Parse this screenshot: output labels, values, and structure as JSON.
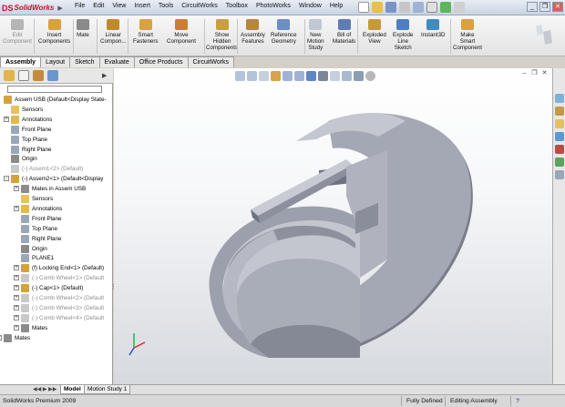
{
  "app": {
    "name": "SolidWorks",
    "logo_mark": "DS"
  },
  "menu": [
    "File",
    "Edit",
    "View",
    "Insert",
    "Tools",
    "CircuitWorks",
    "Toolbox",
    "PhotoWorks",
    "Window",
    "Help"
  ],
  "command_manager": {
    "buttons": [
      {
        "id": "edit-component",
        "lines": [
          "Edit",
          "Component"
        ],
        "icon": "edit-component-icon",
        "color": "#b5b5b5",
        "disabled": true
      },
      {
        "id": "insert-components",
        "lines": [
          "Insert",
          "Components"
        ],
        "icon": "insert-components-icon",
        "color": "#d9a23a",
        "disabled": false
      },
      {
        "id": "mate",
        "lines": [
          "Mate",
          ""
        ],
        "icon": "mate-icon",
        "color": "#8a8a8a",
        "disabled": false
      },
      {
        "id": "linear-component",
        "lines": [
          "Linear",
          "Compon..."
        ],
        "icon": "linear-pattern-icon",
        "color": "#c08a2a",
        "disabled": false
      },
      {
        "id": "smart-fasteners",
        "lines": [
          "Smart",
          "Fasteners"
        ],
        "icon": "smart-fasteners-icon",
        "color": "#d9a23a",
        "disabled": false
      },
      {
        "id": "move-component",
        "lines": [
          "Move",
          "Component"
        ],
        "icon": "move-component-icon",
        "color": "#c97f2f",
        "disabled": false
      },
      {
        "id": "show-hidden",
        "lines": [
          "Show",
          "Hidden",
          "Components"
        ],
        "icon": "show-hidden-icon",
        "color": "#c8a040",
        "disabled": false
      },
      {
        "id": "assembly-features",
        "lines": [
          "Assembly",
          "Features"
        ],
        "icon": "assembly-features-icon",
        "color": "#b6863a",
        "disabled": false
      },
      {
        "id": "reference-geometry",
        "lines": [
          "Reference",
          "Geometry"
        ],
        "icon": "reference-geometry-icon",
        "color": "#6a8fc4",
        "disabled": false
      },
      {
        "id": "new-motion-study",
        "lines": [
          "New",
          "Motion",
          "Study"
        ],
        "icon": "motion-study-icon",
        "color": "#c0c8d4",
        "disabled": false
      },
      {
        "id": "bill-of-materials",
        "lines": [
          "Bill of",
          "Materials"
        ],
        "icon": "bom-icon",
        "color": "#5f7db3",
        "disabled": false
      },
      {
        "id": "exploded-view",
        "lines": [
          "Exploded",
          "View"
        ],
        "icon": "exploded-view-icon",
        "color": "#c59a3c",
        "disabled": false
      },
      {
        "id": "explode-line-sketch",
        "lines": [
          "Explode",
          "Line",
          "Sketch"
        ],
        "icon": "explode-line-sketch-icon",
        "color": "#4e7fbf",
        "disabled": false
      },
      {
        "id": "instant3d",
        "lines": [
          "Instant3D",
          ""
        ],
        "icon": "instant3d-icon",
        "color": "#3f8cc0",
        "disabled": false
      },
      {
        "id": "make-smart-component",
        "lines": [
          "Make",
          "Smart",
          "Component"
        ],
        "icon": "smart-component-icon",
        "color": "#d9a23a",
        "disabled": false
      }
    ]
  },
  "command_tabs": [
    {
      "label": "Assembly",
      "active": true
    },
    {
      "label": "Layout",
      "active": false
    },
    {
      "label": "Sketch",
      "active": false
    },
    {
      "label": "Evaluate",
      "active": false
    },
    {
      "label": "Office Products",
      "active": false
    },
    {
      "label": "CircuitWorks",
      "active": false
    }
  ],
  "feature_tree": {
    "nodes": [
      {
        "label": "Assem USB  (Default<Display State-",
        "level": 0,
        "icon": "assembly-icon",
        "color": "#d4a23a",
        "expander": "",
        "grey": false
      },
      {
        "label": "Sensors",
        "level": 1,
        "icon": "sensors-icon",
        "color": "#e6c35a",
        "expander": "",
        "grey": false
      },
      {
        "label": "Annotations",
        "level": 1,
        "icon": "annotations-icon",
        "color": "#e2b94a",
        "expander": "+",
        "grey": false
      },
      {
        "label": "Front Plane",
        "level": 1,
        "icon": "plane-icon",
        "color": "#9aa7b8",
        "expander": "",
        "grey": false
      },
      {
        "label": "Top Plane",
        "level": 1,
        "icon": "plane-icon",
        "color": "#9aa7b8",
        "expander": "",
        "grey": false
      },
      {
        "label": "Right Plane",
        "level": 1,
        "icon": "plane-icon",
        "color": "#9aa7b8",
        "expander": "",
        "grey": false
      },
      {
        "label": "Origin",
        "level": 1,
        "icon": "origin-icon",
        "color": "#8a8a8a",
        "expander": "",
        "grey": false
      },
      {
        "label": "(-) Assem1<2> (Default)",
        "level": 1,
        "icon": "subassembly-icon",
        "color": "#c9c9c9",
        "expander": "",
        "grey": true
      },
      {
        "label": "(-) Assem2<1> (Default<Display",
        "level": 1,
        "icon": "subassembly-icon",
        "color": "#d4a23a",
        "expander": "-",
        "grey": false
      },
      {
        "label": "Mates in Assem USB",
        "level": 2,
        "icon": "mates-icon",
        "color": "#8c8c8c",
        "expander": "+",
        "grey": false
      },
      {
        "label": "Sensors",
        "level": 2,
        "icon": "sensors-icon",
        "color": "#e6c35a",
        "expander": "",
        "grey": false
      },
      {
        "label": "Annotations",
        "level": 2,
        "icon": "annotations-icon",
        "color": "#e2b94a",
        "expander": "+",
        "grey": false
      },
      {
        "label": "Front Plane",
        "level": 2,
        "icon": "plane-icon",
        "color": "#9aa7b8",
        "expander": "",
        "grey": false
      },
      {
        "label": "Top Plane",
        "level": 2,
        "icon": "plane-icon",
        "color": "#9aa7b8",
        "expander": "",
        "grey": false
      },
      {
        "label": "Right Plane",
        "level": 2,
        "icon": "plane-icon",
        "color": "#9aa7b8",
        "expander": "",
        "grey": false
      },
      {
        "label": "Origin",
        "level": 2,
        "icon": "origin-icon",
        "color": "#8a8a8a",
        "expander": "",
        "grey": false
      },
      {
        "label": "PLANE1",
        "level": 2,
        "icon": "plane-icon",
        "color": "#9aa7b8",
        "expander": "",
        "grey": false
      },
      {
        "label": "(f) Locking End<1> (Default)",
        "level": 2,
        "icon": "part-icon",
        "color": "#d4a23a",
        "expander": "+",
        "grey": false
      },
      {
        "label": "(-) Comb Wheel<1> (Default",
        "level": 2,
        "icon": "part-icon",
        "color": "#c9c9c9",
        "expander": "+",
        "grey": true
      },
      {
        "label": "(-) Cap<1> (Default)",
        "level": 2,
        "icon": "part-icon",
        "color": "#d4a23a",
        "expander": "+",
        "grey": false
      },
      {
        "label": "(-) Comb Wheel<2> (Default",
        "level": 2,
        "icon": "part-icon",
        "color": "#c9c9c9",
        "expander": "+",
        "grey": true
      },
      {
        "label": "(-) Comb Wheel<3> (Default",
        "level": 2,
        "icon": "part-icon",
        "color": "#c9c9c9",
        "expander": "+",
        "grey": true
      },
      {
        "label": "(-) Comb Wheel<4> (Default",
        "level": 2,
        "icon": "part-icon",
        "color": "#c9c9c9",
        "expander": "+",
        "grey": true
      },
      {
        "label": "Mates",
        "level": 2,
        "icon": "mates-icon",
        "color": "#8c8c8c",
        "expander": "+",
        "grey": false
      },
      {
        "label": "Mates",
        "level": 0,
        "icon": "mates-icon",
        "color": "#8c8c8c",
        "expander": "+",
        "grey": false
      }
    ]
  },
  "bottom_tabs": [
    {
      "label": "Model",
      "active": true
    },
    {
      "label": "Motion Study 1",
      "active": false
    }
  ],
  "status": {
    "product": "SolidWorks Premium 2009",
    "state": "Fully Defined",
    "mode": "Editing Assembly",
    "help": "?"
  },
  "colors": {
    "model_face_light": "#b9bcc6",
    "model_face_mid": "#9ea2ae",
    "model_face_dark": "#6c707c",
    "accent_red": "#c8102e"
  }
}
